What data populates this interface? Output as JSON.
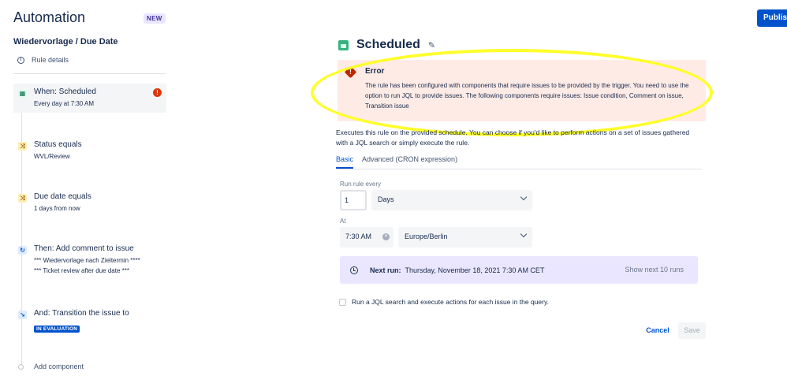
{
  "header": {
    "app_title": "Automation",
    "new_badge": "NEW",
    "publish_label": "Publish"
  },
  "sidebar": {
    "rule_name": "Wiedervorlage / Due Date",
    "rule_details": "Rule details",
    "steps": [
      {
        "title": "When: Scheduled",
        "sub": "Every day at 7:30 AM",
        "icon": "calendar-icon",
        "has_error": true,
        "selected": true
      },
      {
        "title": "Status equals",
        "sub": "WVL/Review",
        "icon": "condition-icon"
      },
      {
        "title": "Due date equals",
        "sub": "1 days from now",
        "icon": "condition-icon"
      },
      {
        "title": "Then: Add comment to issue",
        "sub": "*** Wiedervorlage nach Zieltermin ****",
        "sub2": "*** Ticket review after due date ***",
        "icon": "action-icon"
      },
      {
        "title": "And: Transition the issue to",
        "status": "IN EVALUATION",
        "icon": "transition-icon"
      }
    ],
    "add_component": "Add component"
  },
  "main": {
    "title": "Scheduled",
    "error": {
      "title": "Error",
      "message": "The rule has been configured with components that require issues to be provided by the trigger. You need to use the option to run JQL to provide issues. The following components require issues: Issue condition, Comment on issue, Transition issue"
    },
    "description": "Executes this rule on the provided schedule. You can choose if you'd like to perform actions on a set of issues gathered with a JQL search or simply execute the rule.",
    "tabs": [
      "Basic",
      "Advanced (CRON expression)"
    ],
    "run_every_label": "Run rule every",
    "run_every_value": "1",
    "run_every_unit": "Days",
    "at_label": "At",
    "time_value": "7:30 AM",
    "timezone": "Europe/Berlin",
    "next_run_label": "Next run:",
    "next_run_value": "Thursday, November 18, 2021 7:30 AM CET",
    "show_next": "Show next 10 runs",
    "jql_checkbox_label": "Run a JQL search and execute actions for each issue in the query.",
    "cancel_label": "Cancel",
    "save_label": "Save"
  },
  "colors": {
    "accent": "#0052cc",
    "error_bg": "#ffebe6",
    "highlight": "#ffff29",
    "next_run_bg": "#eae6ff"
  }
}
